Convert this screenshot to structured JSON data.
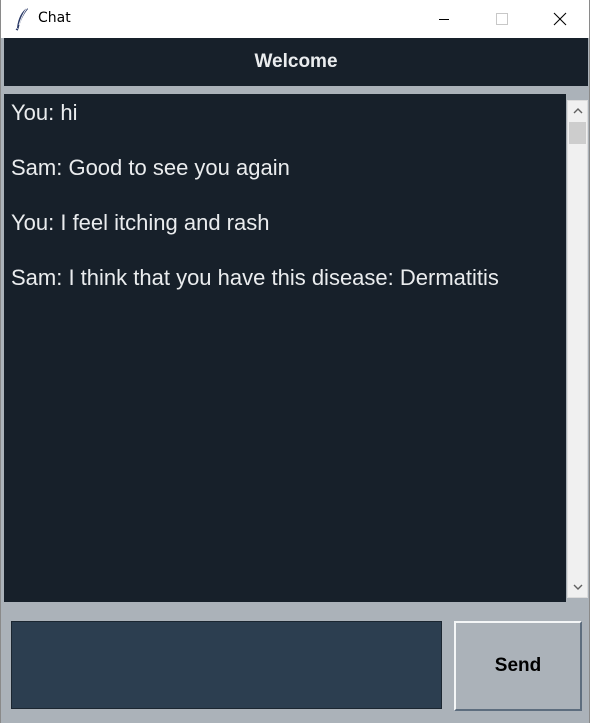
{
  "window": {
    "title": "Chat",
    "icon": "feather-icon",
    "controls": [
      "minimize-icon",
      "maximize-icon",
      "close-icon"
    ]
  },
  "header": {
    "title": "Welcome"
  },
  "messages": [
    "You: hi",
    "Sam: Good to see you again",
    "You: I feel itching and rash",
    "Sam: I think that you have this disease: Dermatitis"
  ],
  "input": {
    "value": "",
    "send_label": "Send"
  },
  "colors": {
    "background": "#abb2b9",
    "panel": "#17202a",
    "text": "#eaecee",
    "entry": "#2c3e50"
  }
}
